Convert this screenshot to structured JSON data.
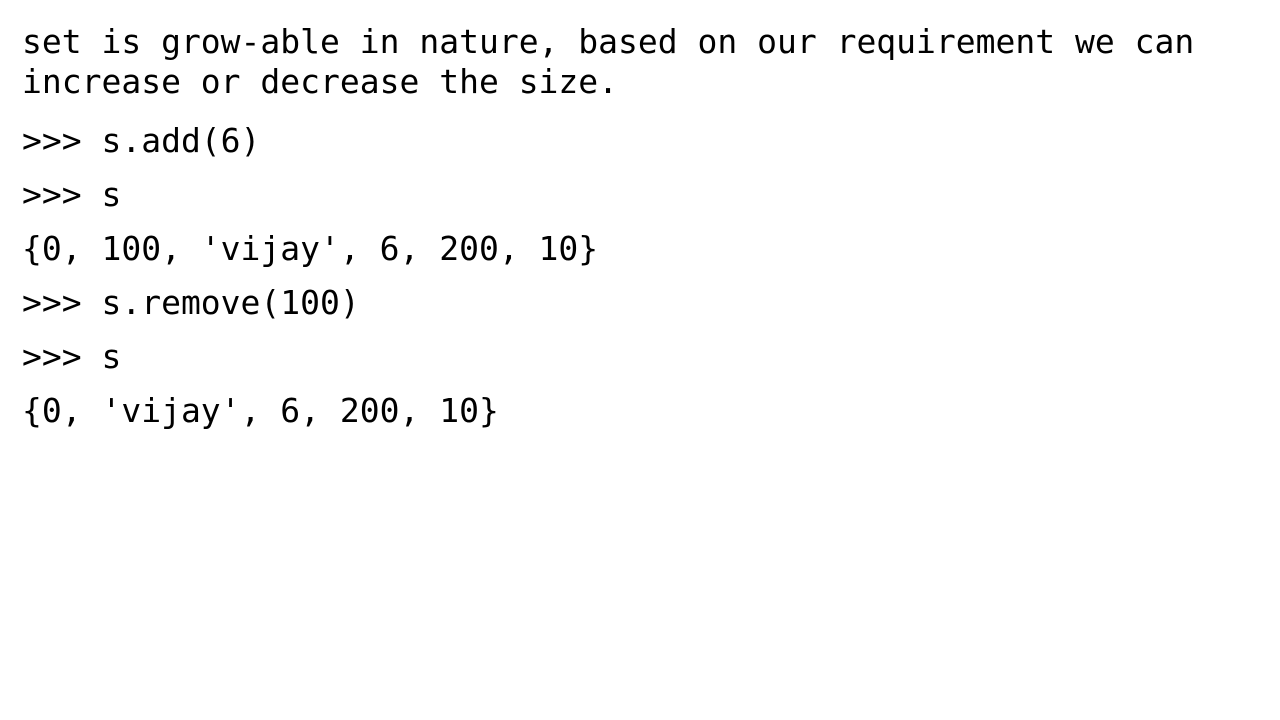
{
  "intro": {
    "line1": "set is grow-able in nature, based on our requirement we can",
    "line2": "increase or decrease the size."
  },
  "code_lines": [
    ">>> s.add(6)",
    ">>> s",
    "{0, 100, 'vijay', 6, 200, 10}",
    ">>> s.remove(100)",
    ">>> s",
    "{0, 'vijay', 6, 200, 10}"
  ]
}
